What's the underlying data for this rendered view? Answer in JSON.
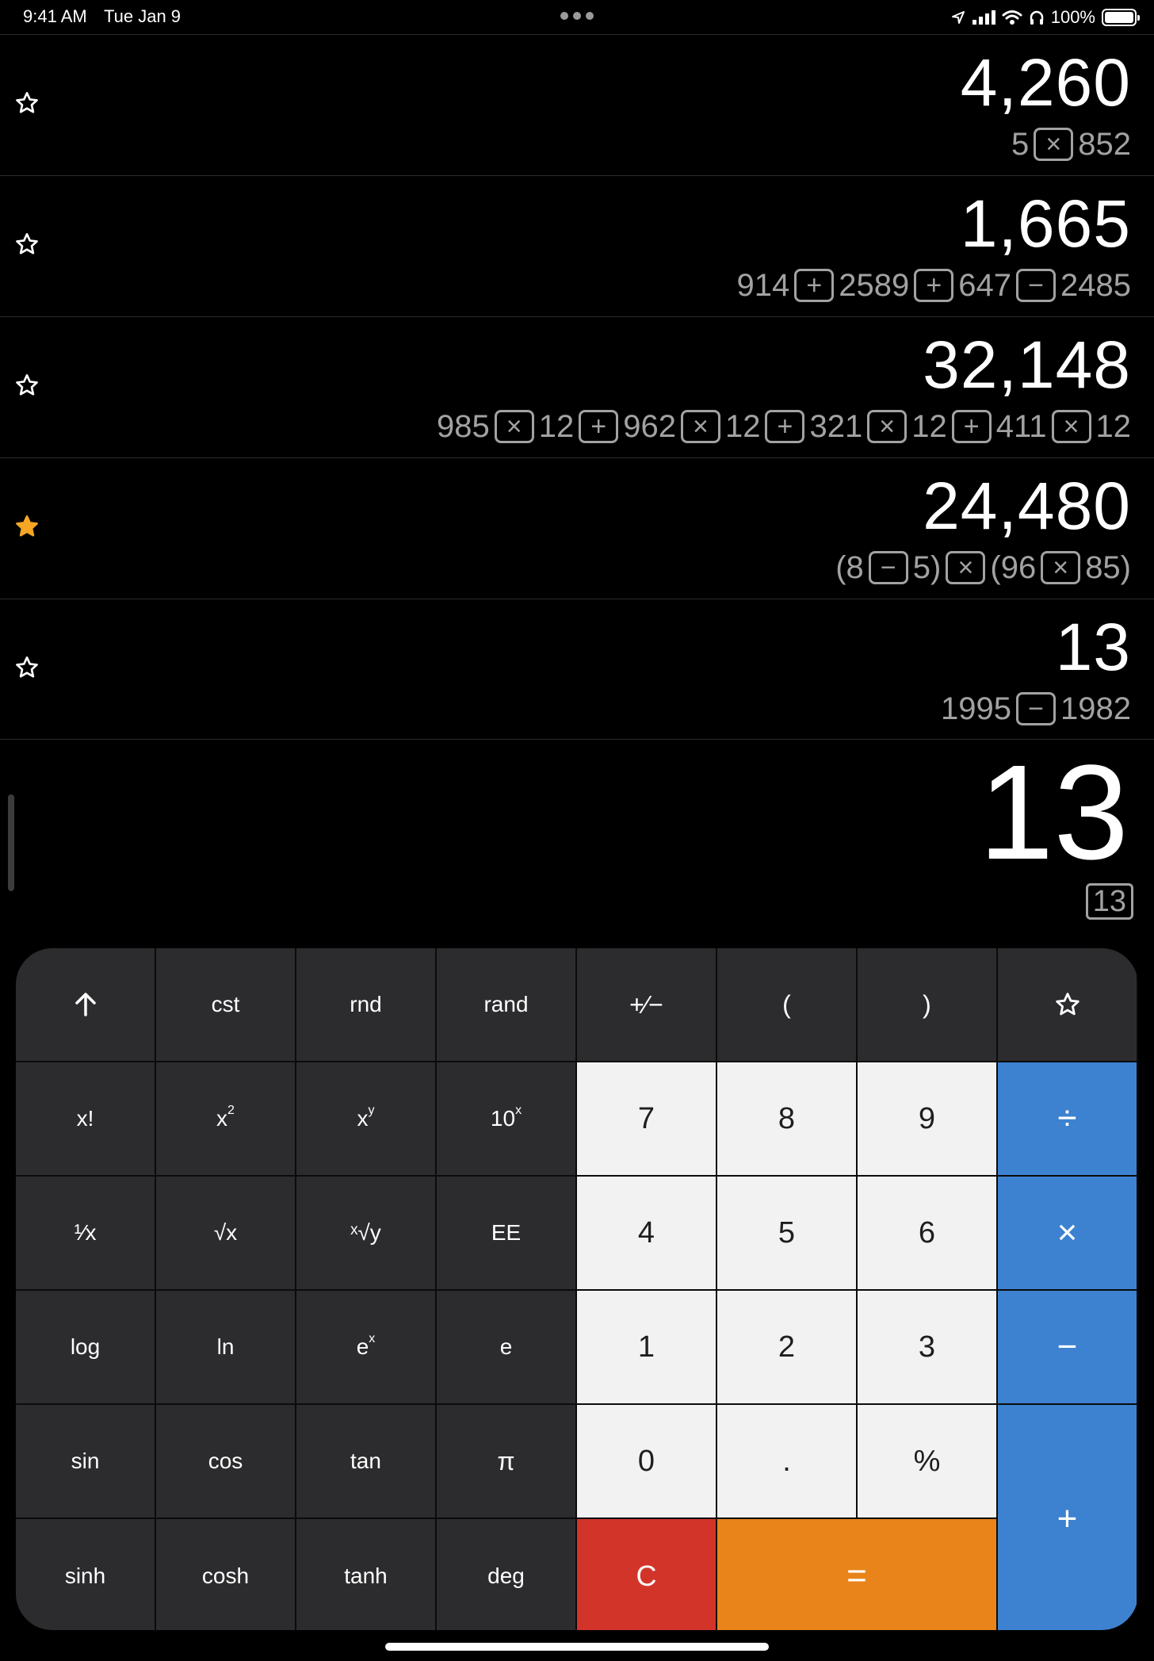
{
  "status_bar": {
    "time": "9:41 AM",
    "date": "Tue Jan 9",
    "battery_percent": "100%",
    "icons": [
      "location-icon",
      "cellular-signal-icon",
      "wifi-icon",
      "headphones-icon",
      "battery-icon"
    ]
  },
  "history": [
    {
      "result": "4,260",
      "starred": false,
      "expression": [
        {
          "t": "num",
          "v": "5"
        },
        {
          "t": "op",
          "v": "×"
        },
        {
          "t": "num",
          "v": "852"
        }
      ]
    },
    {
      "result": "1,665",
      "starred": false,
      "expression": [
        {
          "t": "num",
          "v": "914"
        },
        {
          "t": "op",
          "v": "+"
        },
        {
          "t": "num",
          "v": "2589"
        },
        {
          "t": "op",
          "v": "+"
        },
        {
          "t": "num",
          "v": "647"
        },
        {
          "t": "op",
          "v": "−"
        },
        {
          "t": "num",
          "v": "2485"
        }
      ]
    },
    {
      "result": "32,148",
      "starred": false,
      "expression": [
        {
          "t": "num",
          "v": "985"
        },
        {
          "t": "op",
          "v": "×"
        },
        {
          "t": "num",
          "v": "12"
        },
        {
          "t": "op",
          "v": "+"
        },
        {
          "t": "num",
          "v": "962"
        },
        {
          "t": "op",
          "v": "×"
        },
        {
          "t": "num",
          "v": "12"
        },
        {
          "t": "op",
          "v": "+"
        },
        {
          "t": "num",
          "v": "321"
        },
        {
          "t": "op",
          "v": "×"
        },
        {
          "t": "num",
          "v": "12"
        },
        {
          "t": "op",
          "v": "+"
        },
        {
          "t": "num",
          "v": "411"
        },
        {
          "t": "op",
          "v": "×"
        },
        {
          "t": "num",
          "v": "12"
        }
      ]
    },
    {
      "result": "24,480",
      "starred": true,
      "expression": [
        {
          "t": "num",
          "v": "(8"
        },
        {
          "t": "op",
          "v": "−"
        },
        {
          "t": "num",
          "v": "5)"
        },
        {
          "t": "op",
          "v": "×"
        },
        {
          "t": "num",
          "v": "(96"
        },
        {
          "t": "op",
          "v": "×"
        },
        {
          "t": "num",
          "v": "85)"
        }
      ]
    },
    {
      "result": "13",
      "starred": false,
      "expression": [
        {
          "t": "num",
          "v": "1995"
        },
        {
          "t": "op",
          "v": "−"
        },
        {
          "t": "num",
          "v": "1982"
        }
      ]
    }
  ],
  "current": {
    "result": "13",
    "expression": "13"
  },
  "colors": {
    "star_active": "#f5a623",
    "star_inactive": "#ffffff",
    "operator_key": "#3d82d0",
    "clear_key": "#d3342a",
    "equals_key": "#e8841a",
    "number_key": "#f2f2f2",
    "function_key": "#2c2c2e"
  },
  "keypad": {
    "shift_icon": "arrow-up-icon",
    "cst": "cst",
    "rnd": "rnd",
    "rand": "rand",
    "sign": "+∕−",
    "paren_open": "(",
    "paren_close": ")",
    "favorite_icon": "star-icon",
    "factorial": "x!",
    "square_base": "x",
    "square_exp": "2",
    "power_base": "x",
    "power_exp": "y",
    "ten_pow_base": "10",
    "ten_pow_exp": "x",
    "reciprocal": "¹⁄x",
    "sqrt": "√x",
    "root": "ˣ√y",
    "ee": "EE",
    "log": "log",
    "ln": "ln",
    "exp_base": "e",
    "exp_exp": "x",
    "e": "e",
    "sin": "sin",
    "cos": "cos",
    "tan": "tan",
    "pi": "π",
    "sinh": "sinh",
    "cosh": "cosh",
    "tanh": "tanh",
    "deg": "deg",
    "d7": "7",
    "d8": "8",
    "d9": "9",
    "d4": "4",
    "d5": "5",
    "d6": "6",
    "d1": "1",
    "d2": "2",
    "d3": "3",
    "d0": "0",
    "dot": ".",
    "percent": "%",
    "divide": "÷",
    "multiply": "×",
    "minus": "−",
    "plus": "+",
    "clear": "C",
    "equals": "="
  }
}
